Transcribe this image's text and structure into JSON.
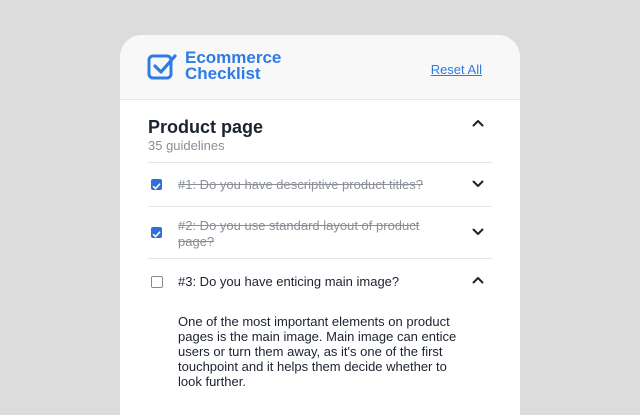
{
  "header": {
    "logo_line1": "Ecommerce",
    "logo_line2": "Checklist",
    "reset_label": "Reset All",
    "accent_color": "#2f7be5",
    "logo_icon": "checkbox-check-icon"
  },
  "section": {
    "title": "Product page",
    "subtitle": "35 guidelines",
    "expanded": true
  },
  "items": [
    {
      "label": "#1: Do you have descriptive product titles?",
      "checked": true,
      "expanded": false
    },
    {
      "label": "#2: Do you use standard layout of product page?",
      "checked": true,
      "expanded": false
    },
    {
      "label": "#3: Do you have enticing main image?",
      "checked": false,
      "expanded": true,
      "description": "One of the most important elements on product pages is the main image. Main image can entice users or turn them away, as it's one of the first touchpoint and it helps them decide whether to look further."
    }
  ]
}
